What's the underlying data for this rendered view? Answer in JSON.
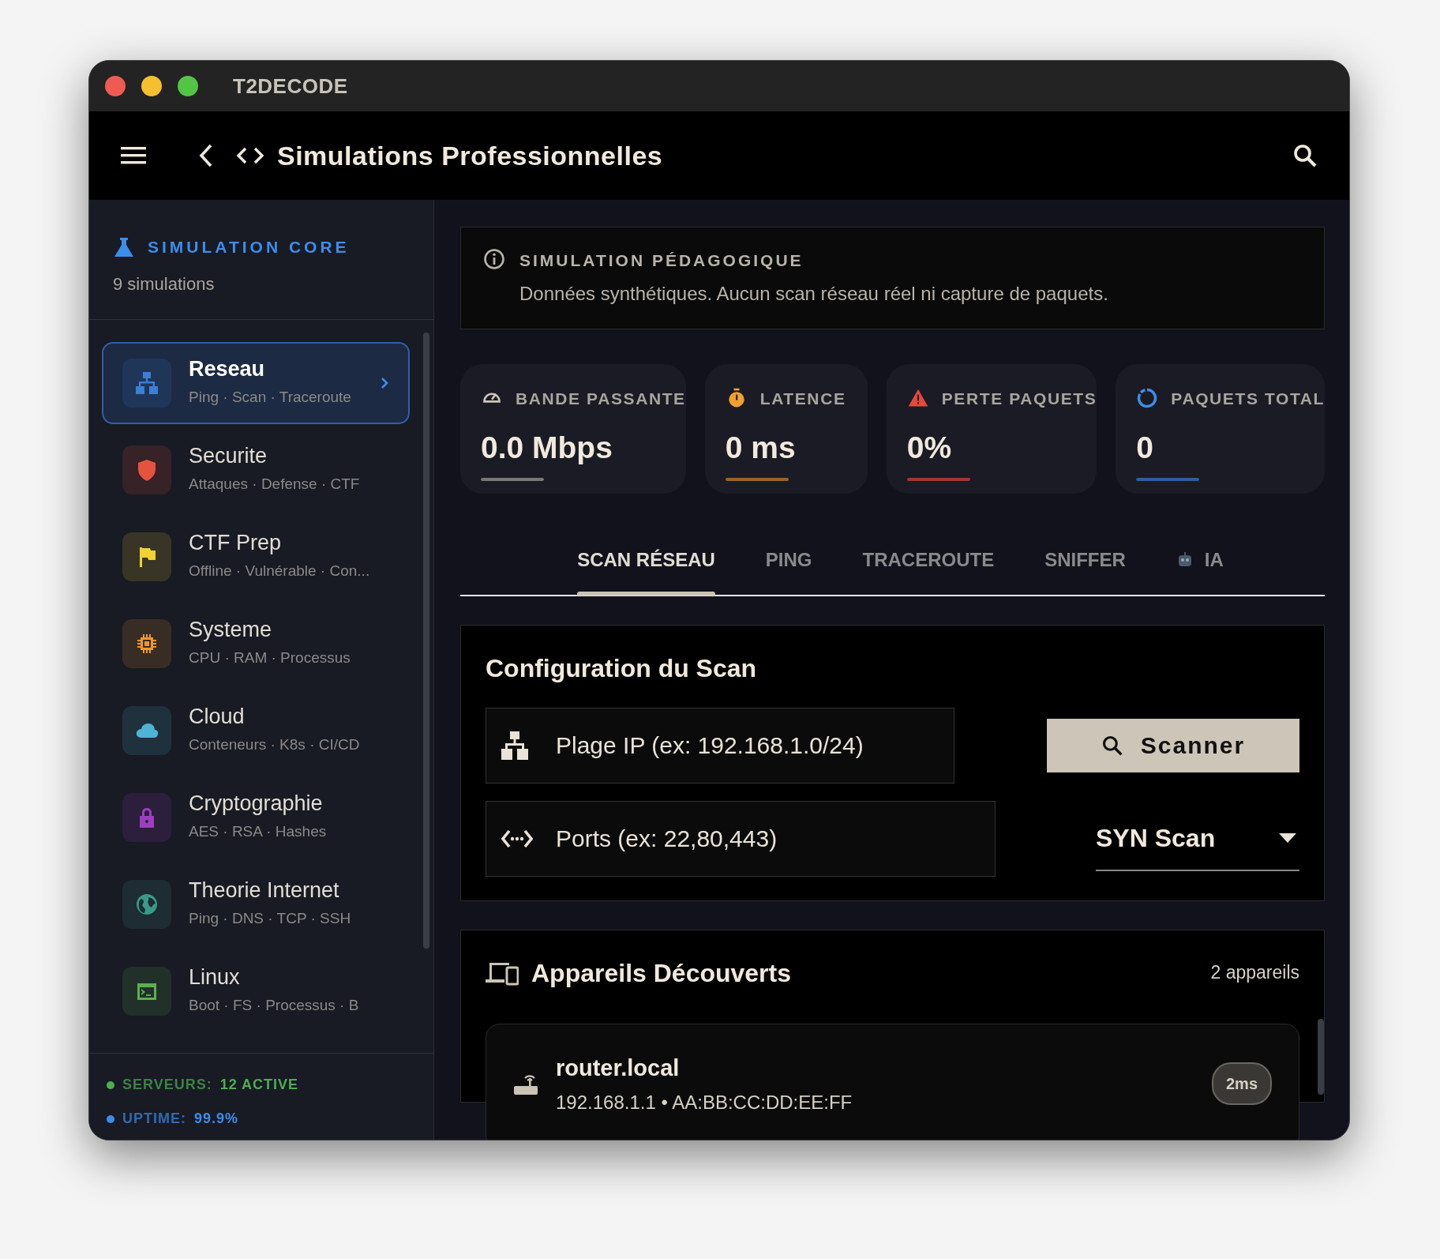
{
  "window": {
    "title": "T2DECODE"
  },
  "navbar": {
    "title": "Simulations Professionnelles"
  },
  "sidebar": {
    "heading": "SIMULATION CORE",
    "count": "9 simulations",
    "items": [
      {
        "title": "Reseau",
        "subtitle": "Ping · Scan · Traceroute",
        "color": "#3b7fd9",
        "selected": true
      },
      {
        "title": "Securite",
        "subtitle": "Attaques · Defense · CTF",
        "color": "#e5533f",
        "selected": false
      },
      {
        "title": "CTF Prep",
        "subtitle": "Offline · Vulnérable · Con...",
        "color": "#f2d233",
        "selected": false
      },
      {
        "title": "Systeme",
        "subtitle": "CPU · RAM · Processus",
        "color": "#f0982a",
        "selected": false
      },
      {
        "title": "Cloud",
        "subtitle": "Conteneurs · K8s · CI/CD",
        "color": "#4fb3d6",
        "selected": false
      },
      {
        "title": "Cryptographie",
        "subtitle": "AES · RSA · Hashes",
        "color": "#9b3fc0",
        "selected": false
      },
      {
        "title": "Theorie Internet",
        "subtitle": "Ping · DNS · TCP · SSH",
        "color": "#3a9a8a",
        "selected": false
      },
      {
        "title": "Linux",
        "subtitle": "Boot · FS · Processus · B",
        "color": "#5bb04e",
        "selected": false
      }
    ],
    "status": [
      {
        "label": "SERVEURS:",
        "value": "12 ACTIVE",
        "color": "#4caf50"
      },
      {
        "label": "UPTIME:",
        "value": "99.9%",
        "color": "#3b8eea"
      }
    ]
  },
  "notice": {
    "title": "SIMULATION PÉDAGOGIQUE",
    "text": "Données synthétiques. Aucun scan réseau réel ni capture de paquets."
  },
  "stats": [
    {
      "label": "BANDE PASSANTE",
      "value": "0.0 Mbps",
      "color": "#7a7876"
    },
    {
      "label": "LATENCE",
      "value": "0 ms",
      "color": "#9a6424"
    },
    {
      "label": "PERTE PAQUETS",
      "value": "0%",
      "color": "#9e3730"
    },
    {
      "label": "PAQUETS TOTAL",
      "value": "0",
      "color": "#2f5d9c"
    }
  ],
  "tabs": [
    {
      "label": "SCAN RÉSEAU",
      "selected": true
    },
    {
      "label": "PING",
      "selected": false
    },
    {
      "label": "TRACEROUTE",
      "selected": false
    },
    {
      "label": "SNIFFER",
      "selected": false
    },
    {
      "label": "IA",
      "selected": false
    }
  ],
  "scan_config": {
    "title": "Configuration du Scan",
    "ip_placeholder": "Plage IP (ex: 192.168.1.0/24)",
    "ports_placeholder": "Ports (ex: 22,80,443)",
    "scan_button": "Scanner",
    "scan_type": "SYN Scan"
  },
  "devices": {
    "title": "Appareils Découverts",
    "count": "2 appareils",
    "items": [
      {
        "name": "router.local",
        "detail": "192.168.1.1 • AA:BB:CC:DD:EE:FF",
        "latency": "2ms"
      }
    ]
  }
}
